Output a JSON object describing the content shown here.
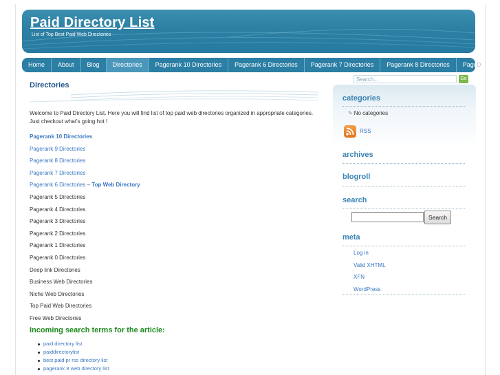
{
  "header": {
    "site_title": "Paid Directory List",
    "tagline": "List of Top Best Paid Web Directories"
  },
  "nav": {
    "items": [
      {
        "label": "Home"
      },
      {
        "label": "About"
      },
      {
        "label": "Blog"
      },
      {
        "label": "Directories",
        "active": true
      },
      {
        "label": "Pagerank 10 Directories"
      },
      {
        "label": "Pagerank 6 Directories"
      },
      {
        "label": "Pagerank 7 Directories"
      },
      {
        "label": "Pagerank 8 Directories"
      },
      {
        "label": "Pagerank"
      }
    ],
    "overflow_text": "D"
  },
  "top_search": {
    "placeholder": "Search...",
    "go_label": "Go"
  },
  "main": {
    "title": "Directories",
    "intro": "Welcome to Paid Directory List. Here you will find list of top paid web directories organized in appropriate categories. Just checkout what's going hot !",
    "links": [
      {
        "text": "Pagerank 10 Directories",
        "style": "blue-bold"
      },
      {
        "text": "Pagerank 9 Directories",
        "style": "blue"
      },
      {
        "text": "Pagerank 8 Directories",
        "style": "blue"
      },
      {
        "text": "Pagerank 7 Directories",
        "style": "blue"
      },
      {
        "text": "Pagerank 6 Directories",
        "style": "blue",
        "suffix": " – ",
        "extra": "Top Web Directory"
      },
      {
        "text": "Pagerank 5 Directories",
        "style": "plain"
      },
      {
        "text": "Pagerank 4 Directories",
        "style": "plain"
      },
      {
        "text": "Pagerank 3 Directories",
        "style": "plain"
      },
      {
        "text": "Pagerank 2 Directories",
        "style": "plain"
      },
      {
        "text": "Pagerank 1 Directories",
        "style": "plain"
      },
      {
        "text": "Pagerank 0 Directories",
        "style": "plain"
      },
      {
        "text": "Deep link Directories",
        "style": "plain"
      },
      {
        "text": "Business Web Directories",
        "style": "plain"
      },
      {
        "text": "Niche Web Directories",
        "style": "plain"
      },
      {
        "text": "Top Paid Web Directories",
        "style": "plain"
      },
      {
        "text": "Free Web Directories",
        "style": "plain"
      }
    ],
    "incoming_heading": "Incoming search terms for the article:",
    "search_terms": [
      "paid directory list",
      "paiddirectorylist",
      "best paid pr rss directory list",
      "pagerank 8 web directory list"
    ]
  },
  "sidebar": {
    "categories_heading": "categories",
    "no_categories": "No categories",
    "rss_label": "RSS",
    "archives_heading": "archives",
    "blogroll_heading": "blogroll",
    "search_heading": "search",
    "search_button": "Search",
    "meta_heading": "meta",
    "meta_links": [
      "Log in",
      "Valid XHTML",
      "XFN",
      "WordPress"
    ]
  },
  "colors": {
    "header_blue": "#2d7fa3",
    "link_blue": "#3a77c2",
    "title_navy": "#21548a",
    "heading_green": "#1f8a1f",
    "sidebar_heading": "#3a84b3",
    "rss_orange": "#e2731a"
  }
}
